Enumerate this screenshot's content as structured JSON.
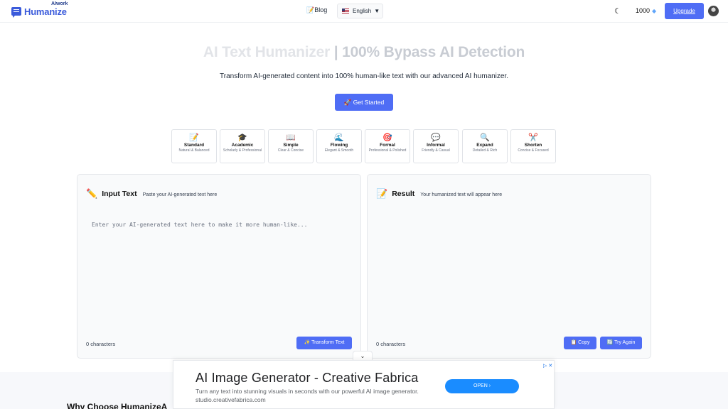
{
  "header": {
    "logo_sub": "AIwork",
    "logo_text": "Humanize",
    "blog_label": "📝Blog",
    "language": "English",
    "credits": "1000",
    "upgrade_label": "Upgrade"
  },
  "hero": {
    "title_a": "AI Text Humanizer",
    "title_b": " | 100% Bypass AI Detection",
    "subtitle": "Transform AI-generated content into 100% human-like text with our advanced AI humanizer.",
    "cta": "🚀 Get Started"
  },
  "modes": [
    {
      "icon": "📝",
      "name": "Standard",
      "desc": "Natural & Balanced"
    },
    {
      "icon": "🎓",
      "name": "Academic",
      "desc": "Scholarly & Professional"
    },
    {
      "icon": "📖",
      "name": "Simple",
      "desc": "Clear & Concise"
    },
    {
      "icon": "🌊",
      "name": "Flowing",
      "desc": "Elegant & Smooth"
    },
    {
      "icon": "🎯",
      "name": "Formal",
      "desc": "Professional & Polished"
    },
    {
      "icon": "💬",
      "name": "Informal",
      "desc": "Friendly & Casual"
    },
    {
      "icon": "🔍",
      "name": "Expand",
      "desc": "Detailed & Rich"
    },
    {
      "icon": "✂️",
      "name": "Shorten",
      "desc": "Concise & Focused"
    }
  ],
  "input_panel": {
    "icon": "✏️",
    "title": "Input Text",
    "subtitle": "Paste your AI-generated text here",
    "placeholder": "Enter your AI-generated text here to make it more human-like...",
    "value": "",
    "char_count": "0 characters",
    "transform_label": "✨ Transform Text"
  },
  "result_panel": {
    "icon": "📝",
    "title": "Result",
    "subtitle": "Your humanized text will appear here",
    "char_count": "0 characters",
    "copy_label": "📋 Copy",
    "retry_label": "🔄 Try Again"
  },
  "ad": {
    "title": "AI Image Generator - Creative Fabrica",
    "description": "Turn any text into stunning visuals in seconds with our powerful AI image generator. studio.creativefabrica.com",
    "open_label": "OPEN ›",
    "badge": "▷ ✕"
  },
  "why_heading": "Why Choose HumanizeA"
}
